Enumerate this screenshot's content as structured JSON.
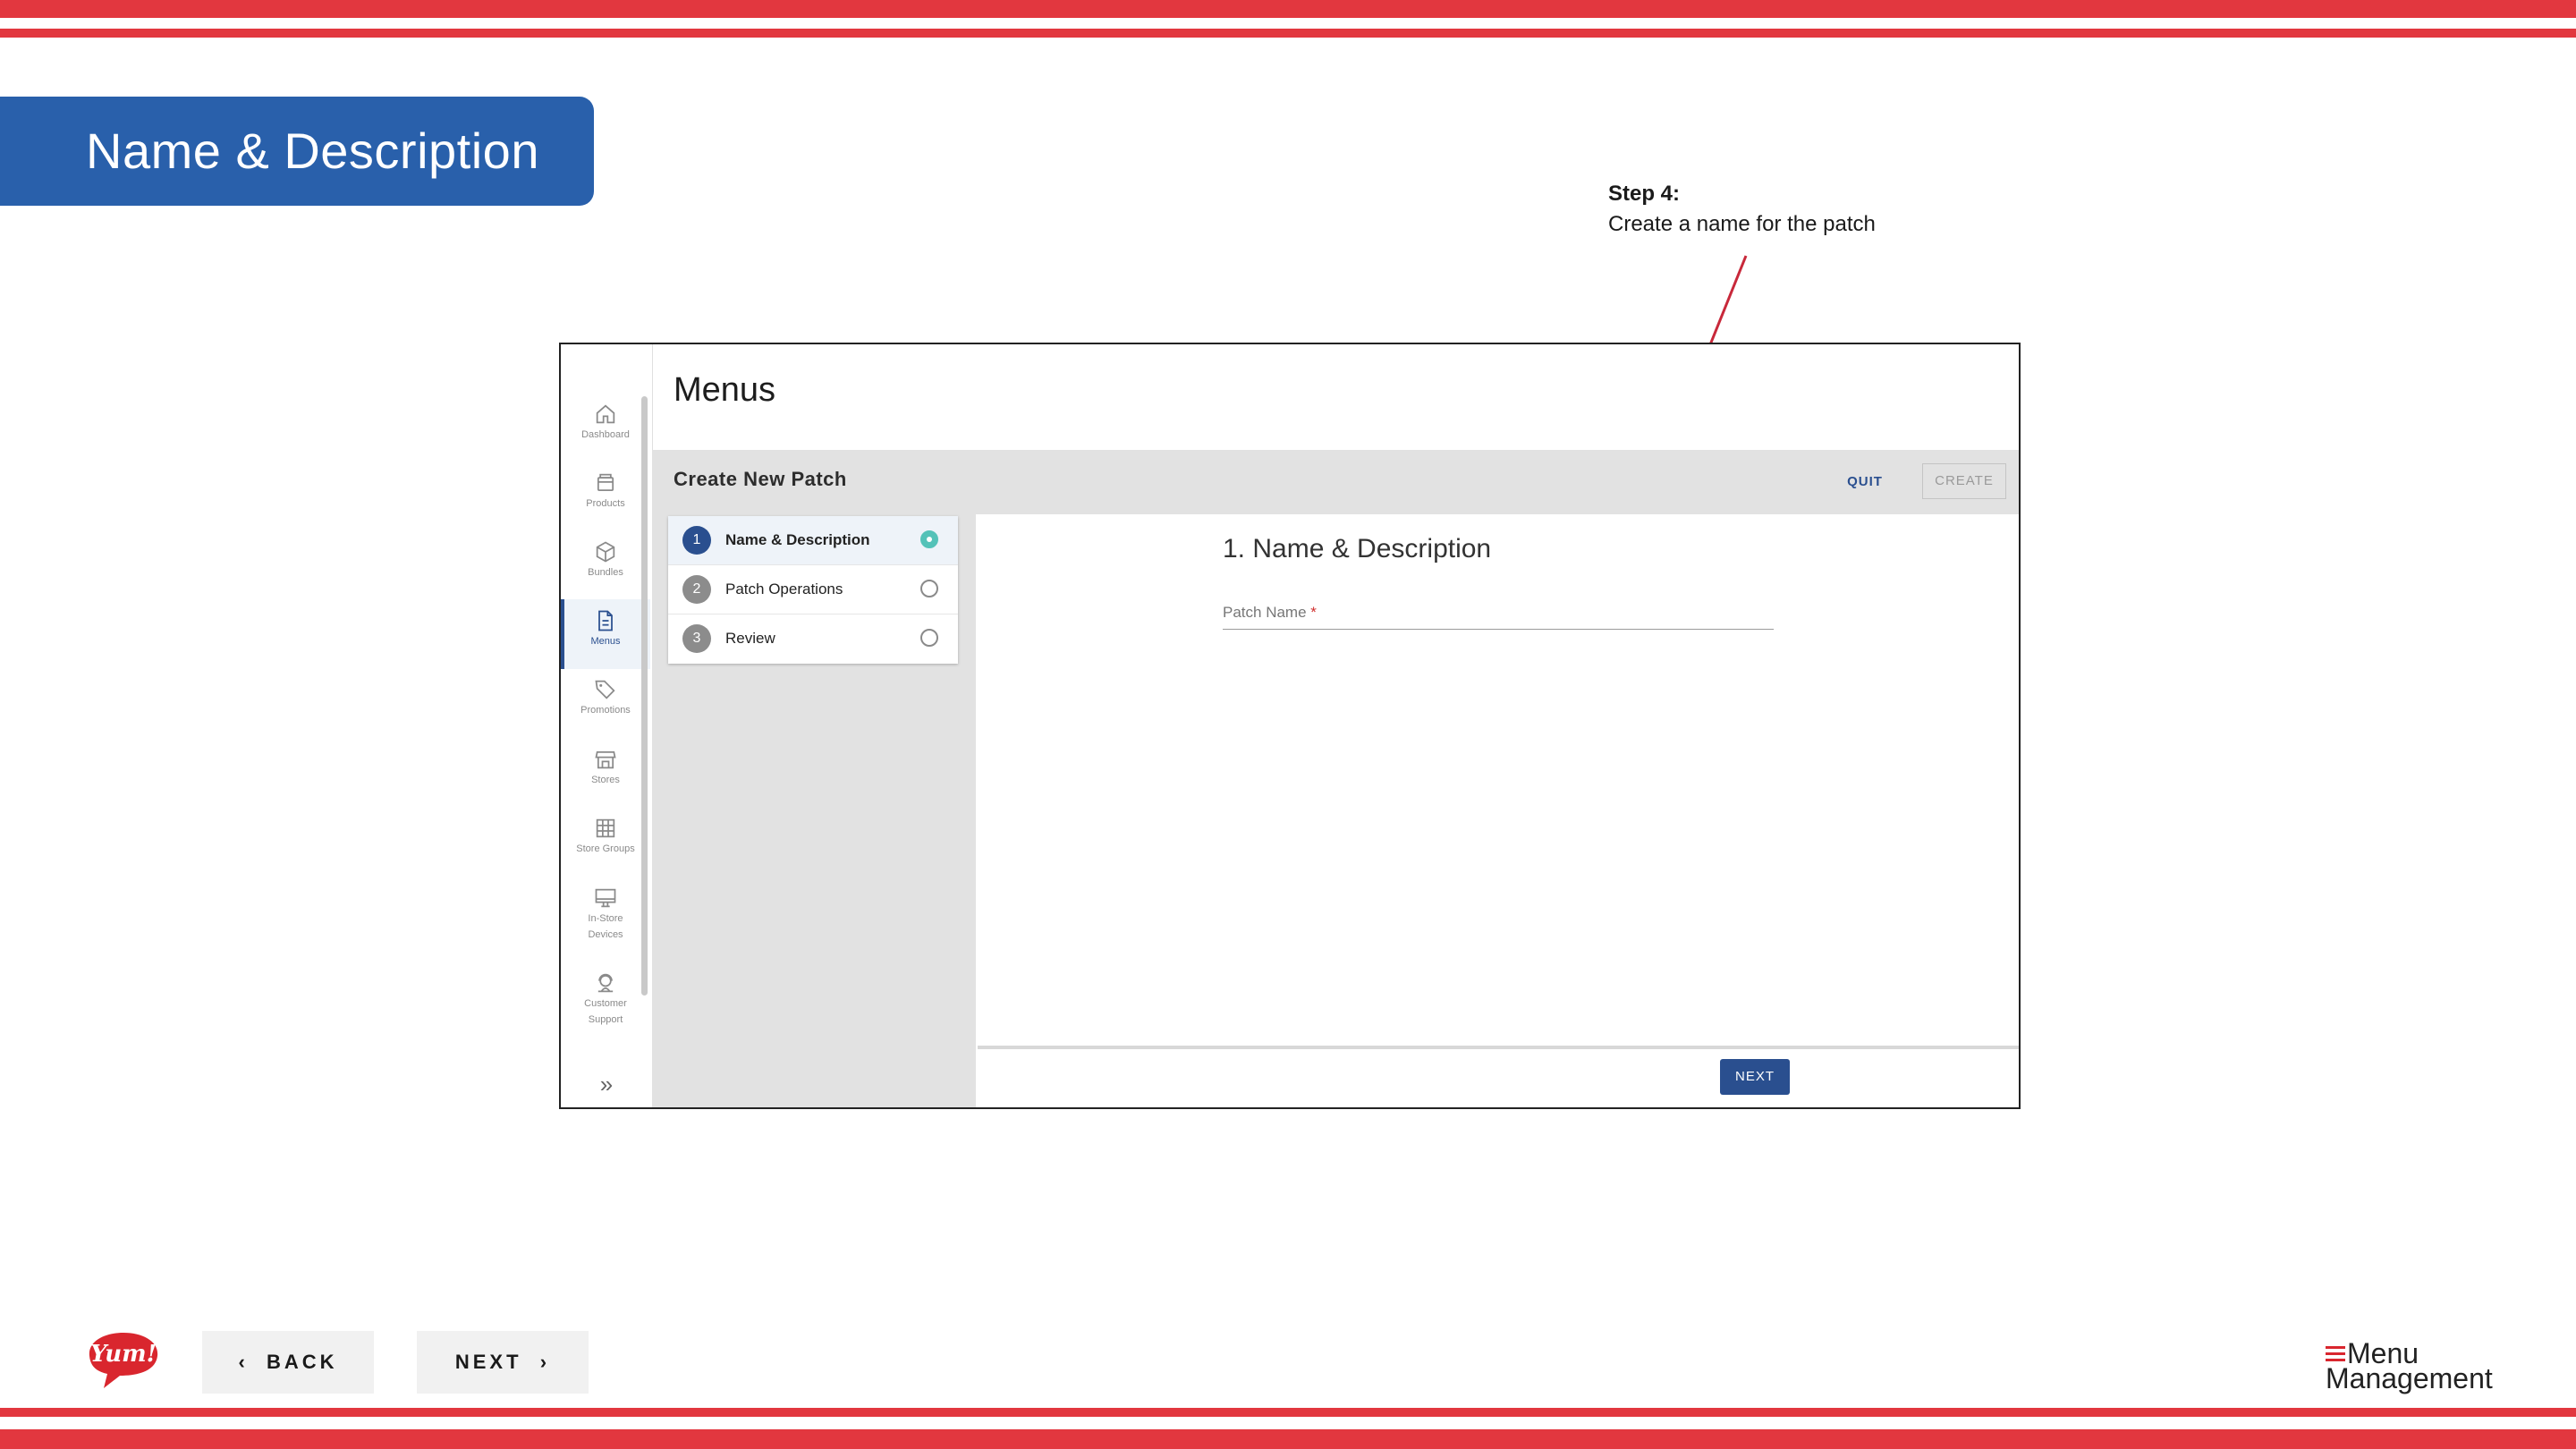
{
  "slide": {
    "title": "Name & Description",
    "annotation": {
      "step": "Step 4:",
      "text": "Create a name for the patch"
    }
  },
  "app": {
    "page_title": "Menus",
    "sidebar": {
      "items": [
        {
          "label": "Dashboard",
          "icon": "home-icon"
        },
        {
          "label": "Products",
          "icon": "box-icon"
        },
        {
          "label": "Bundles",
          "icon": "cube-icon"
        },
        {
          "label": "Menus",
          "icon": "document-icon",
          "active": true
        },
        {
          "label": "Promotions",
          "icon": "tag-icon"
        },
        {
          "label": "Stores",
          "icon": "store-icon"
        },
        {
          "label": "Store Groups",
          "icon": "grid-icon"
        },
        {
          "label": "In-Store Devices",
          "icon": "monitor-icon"
        },
        {
          "label": "Customer Support",
          "icon": "support-icon"
        }
      ],
      "expand_icon": "double-chevron-right-icon"
    },
    "panel": {
      "title": "Create New Patch",
      "quit_label": "QUIT",
      "create_label": "CREATE"
    },
    "steps": [
      {
        "num": "1",
        "label": "Name & Description",
        "active": true
      },
      {
        "num": "2",
        "label": "Patch Operations"
      },
      {
        "num": "3",
        "label": "Review"
      }
    ],
    "form": {
      "section_title": "1. Name & Description",
      "field_label": "Patch Name",
      "required_mark": "*",
      "next_label": "NEXT"
    }
  },
  "footer": {
    "back_label": "BACK",
    "next_label": "NEXT",
    "yum_logo_text": "Yum!",
    "product_logo": {
      "line1": "Menu",
      "line2": "Management"
    }
  },
  "colors": {
    "stripe": "#e2373f",
    "banner": "#2960ab",
    "accent": "#2a4f8f",
    "radio_active": "#54c2b8"
  }
}
